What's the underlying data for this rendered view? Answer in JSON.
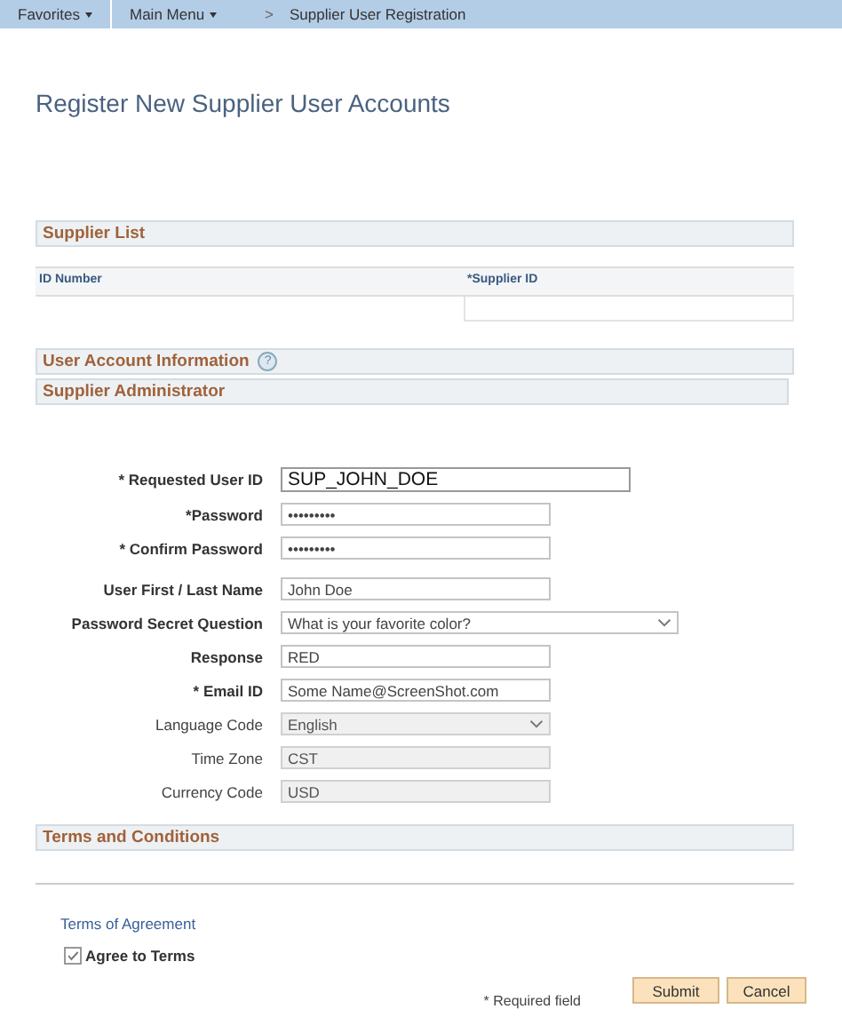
{
  "nav": [
    {
      "label": "Favorites",
      "dropdown": true
    },
    {
      "label": "Main Menu",
      "dropdown": true
    }
  ],
  "breadcrumb": {
    "separator": ">",
    "label": "Supplier User Registration"
  },
  "page_title": "Register New Supplier User Accounts",
  "supplier_list": {
    "title": "Supplier List",
    "columns": [
      "ID Number",
      "*Supplier ID"
    ]
  },
  "user_account_section": {
    "title": "User Account Information",
    "help": "?"
  },
  "admin_section": {
    "title": "Supplier Administrator"
  },
  "fields": [
    {
      "label": "* Requested User ID",
      "value": "SUP_JOHN_DOE",
      "kind": "text",
      "disabled": false
    },
    {
      "label": "*Password",
      "value": "•••••••••",
      "kind": "text",
      "disabled": false
    },
    {
      "label": "* Confirm Password",
      "value": "•••••••••",
      "kind": "text",
      "disabled": false
    },
    {
      "label": "User First / Last Name",
      "value": "John Doe",
      "kind": "text",
      "disabled": false
    },
    {
      "label": "Password Secret Question",
      "value": "What is your favorite color?",
      "kind": "select",
      "disabled": false
    },
    {
      "label": "Response",
      "value": "RED",
      "kind": "text",
      "disabled": false
    },
    {
      "label": "* Email ID",
      "value": "Some Name@ScreenShot.com",
      "kind": "text",
      "disabled": false
    },
    {
      "label": "Language Code",
      "value": "English",
      "kind": "select",
      "disabled": true
    },
    {
      "label": "Time Zone",
      "value": "CST",
      "kind": "text",
      "disabled": true
    },
    {
      "label": "Currency Code",
      "value": "USD",
      "kind": "text",
      "disabled": true
    }
  ],
  "terms_section": {
    "title": "Terms and Conditions"
  },
  "terms_link": "Terms of Agreement",
  "agree": {
    "label": "Agree to Terms",
    "checked": true
  },
  "required_note": "* Required field",
  "buttons": [
    "Submit",
    "Cancel"
  ]
}
